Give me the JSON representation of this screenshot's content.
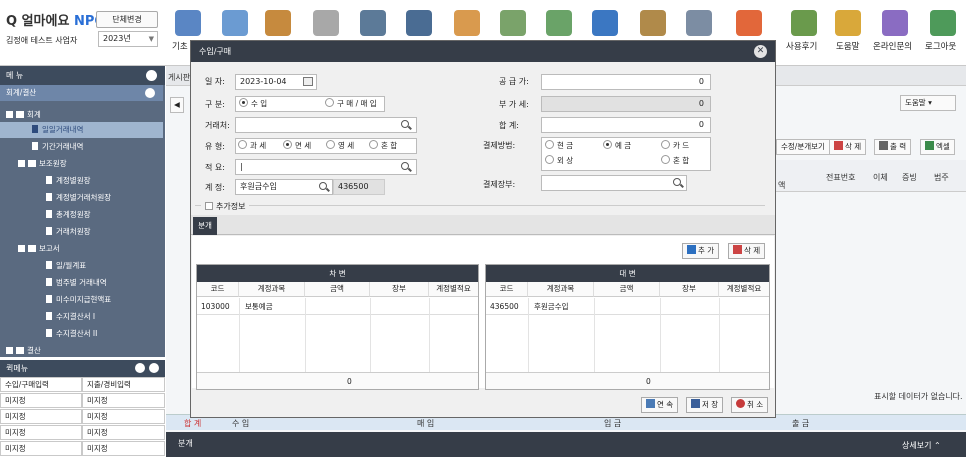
{
  "header": {
    "logo_text": "얼마에요",
    "logo_npo": "NPO",
    "org_change_button": "단체변경",
    "user_name": "김정애 테스트 사업자",
    "year": "2023년",
    "left_label": "기초",
    "right_tools": [
      "사용후기",
      "도움말",
      "온라인문의",
      "로그아웃"
    ]
  },
  "menu": {
    "title": "메 뉴",
    "active_section": "회계/결산",
    "tree": [
      {
        "label": "회계",
        "level": 0
      },
      {
        "label": "일일거래내역",
        "level": 1,
        "selected": true
      },
      {
        "label": "기간거래내역",
        "level": 1
      },
      {
        "label": "보조원장",
        "level": 0
      },
      {
        "label": "계정별원장",
        "level": 1
      },
      {
        "label": "계정별거래처원장",
        "level": 1
      },
      {
        "label": "총계정원장",
        "level": 1
      },
      {
        "label": "거래처원장",
        "level": 1
      },
      {
        "label": "보고서",
        "level": 0
      },
      {
        "label": "일/월계표",
        "level": 1
      },
      {
        "label": "범주별 거래내역",
        "level": 1
      },
      {
        "label": "미수미지급현액표",
        "level": 1
      },
      {
        "label": "수지결산서 I",
        "level": 1
      },
      {
        "label": "수지결산서 II",
        "level": 1
      },
      {
        "label": "결산",
        "level": 0
      }
    ],
    "quick_title": "퀵메뉴",
    "quick_items": [
      "수입/구매입력",
      "지출/경비입력",
      "미지정",
      "미지정",
      "미지정",
      "미지정",
      "미지정",
      "미지정",
      "미지정",
      "미지정"
    ]
  },
  "background": {
    "tab_label": "게시판",
    "help_dropdown": "도움말",
    "toolbar": [
      "수정/분개보기",
      "삭 제",
      "출 력",
      "엑셀"
    ],
    "columns": [
      "액",
      "전표번호",
      "이체",
      "증빙",
      "범주"
    ],
    "empty_message": "표시할 데이터가 없습니다.",
    "summary": [
      "합 계",
      "수 입",
      "매 입",
      "입 금",
      "출 금"
    ],
    "bottom_tab": "분개",
    "detail_toggle": "상세보기"
  },
  "modal": {
    "title": "수입/구매",
    "date_label": "일  자:",
    "date_value": "2023-10-04",
    "type_label": "구  분:",
    "type_options": [
      {
        "label": "수 입",
        "selected": true
      },
      {
        "label": "구 매 / 매 입",
        "selected": false
      }
    ],
    "client_label": "거래처:",
    "client_value": "",
    "tax_label": "유  형:",
    "tax_options": [
      {
        "label": "과 세",
        "selected": false
      },
      {
        "label": "면 세",
        "selected": true
      },
      {
        "label": "영 세",
        "selected": false
      },
      {
        "label": "혼 합",
        "selected": false
      }
    ],
    "summary_label": "적  요:",
    "summary_value": "|",
    "account_label": "계  정:",
    "account_name": "후원금수입",
    "account_code": "436500",
    "supply_label": "공 급 가:",
    "supply_value": "0",
    "vat_label": "부 가 세:",
    "vat_value": "0",
    "total_label": "합     계:",
    "total_value": "0",
    "pay_label": "결제방법:",
    "pay_options": [
      {
        "label": "현 금",
        "selected": false
      },
      {
        "label": "예 금",
        "selected": true
      },
      {
        "label": "카 드",
        "selected": false
      },
      {
        "label": "외 상",
        "selected": false
      },
      {
        "label": "혼 합",
        "selected": false
      }
    ],
    "pay_book_label": "결제장부:",
    "pay_book_value": "",
    "extra_info": "추가정보",
    "tab": "분개",
    "add_button": "추 가",
    "delete_button": "삭 제",
    "debit_title": "차 변",
    "credit_title": "대 변",
    "grid_columns": [
      "코드",
      "계정과목",
      "금액",
      "장부",
      "계정별적요"
    ],
    "debit_row": {
      "code": "103000",
      "account": "보통예금"
    },
    "credit_row": {
      "code": "436500",
      "account": "후원금수입"
    },
    "debit_total": "0",
    "credit_total": "0",
    "continue_button": "연 속",
    "save_button": "저 장",
    "cancel_button": "취 소"
  }
}
